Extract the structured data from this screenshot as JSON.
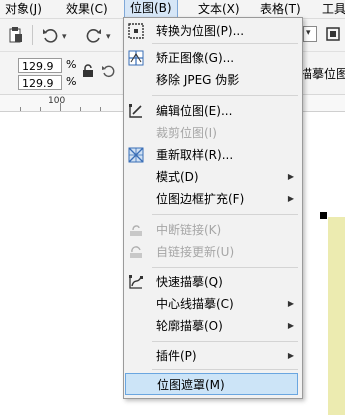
{
  "menubar": {
    "items": [
      {
        "label": "对象(J)"
      },
      {
        "label": "效果(C)"
      },
      {
        "label": "位图(B)"
      },
      {
        "label": "文本(X)"
      },
      {
        "label": "表格(T)"
      },
      {
        "label": "工具"
      }
    ],
    "active_index": 2
  },
  "toolbar": {
    "width_value": "129.9",
    "height_value": "129.9",
    "percent": "%",
    "right_fragment": "描摹位图"
  },
  "ruler": {
    "label": "100"
  },
  "dropdown": {
    "items": [
      {
        "label": "转换为位图(P)...",
        "icon": "convert-bitmap-icon",
        "enabled": true
      },
      {
        "label": "矫正图像(G)...",
        "icon": "straighten-image-icon",
        "enabled": true
      },
      {
        "label": "移除 JPEG 伪影",
        "icon": "",
        "enabled": true
      },
      {
        "label": "编辑位图(E)...",
        "icon": "edit-bitmap-icon",
        "enabled": true
      },
      {
        "label": "裁剪位图(I)",
        "icon": "",
        "enabled": false
      },
      {
        "label": "重新取样(R)...",
        "icon": "resample-icon",
        "enabled": true
      },
      {
        "label": "模式(D)",
        "icon": "",
        "enabled": true,
        "submenu": true
      },
      {
        "label": "位图边框扩充(F)",
        "icon": "",
        "enabled": true,
        "submenu": true
      },
      {
        "label": "中断链接(K)",
        "icon": "break-link-icon",
        "enabled": false
      },
      {
        "label": "自链接更新(U)",
        "icon": "update-link-icon",
        "enabled": false
      },
      {
        "label": "快速描摹(Q)",
        "icon": "quick-trace-icon",
        "enabled": true
      },
      {
        "label": "中心线描摹(C)",
        "icon": "",
        "enabled": true,
        "submenu": true
      },
      {
        "label": "轮廓描摹(O)",
        "icon": "",
        "enabled": true,
        "submenu": true
      },
      {
        "label": "插件(P)",
        "icon": "",
        "enabled": true,
        "submenu": true
      },
      {
        "label": "位图遮罩(M)",
        "icon": "",
        "enabled": true,
        "selected": true
      }
    ]
  },
  "colors": {
    "menu_bg": "#f2f2f2",
    "highlight": "#cce4f7",
    "highlight_border": "#6aa6e0",
    "disabled_text": "#a6a6a6",
    "page_fill": "#ecebb0"
  }
}
